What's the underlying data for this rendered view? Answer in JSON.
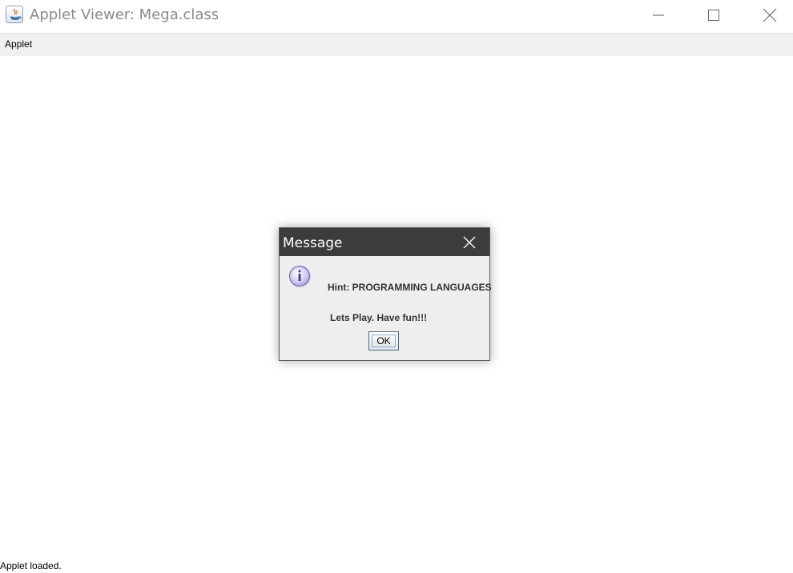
{
  "window": {
    "title": "Applet Viewer: Mega.class"
  },
  "menubar": {
    "items": [
      {
        "label": "Applet"
      }
    ]
  },
  "status": {
    "text": "Applet loaded."
  },
  "dialog": {
    "title": "Message",
    "hint": "Hint: PROGRAMMING LANGUAGES",
    "message": "Lets Play. Have fun!!!",
    "ok_label": "OK",
    "icon": "info-icon"
  },
  "colors": {
    "dialog_titlebar": "#3c3c3c",
    "dialog_body": "#eeeeee",
    "menubar": "#f0f0f0",
    "title_text": "#8a8a8a"
  }
}
